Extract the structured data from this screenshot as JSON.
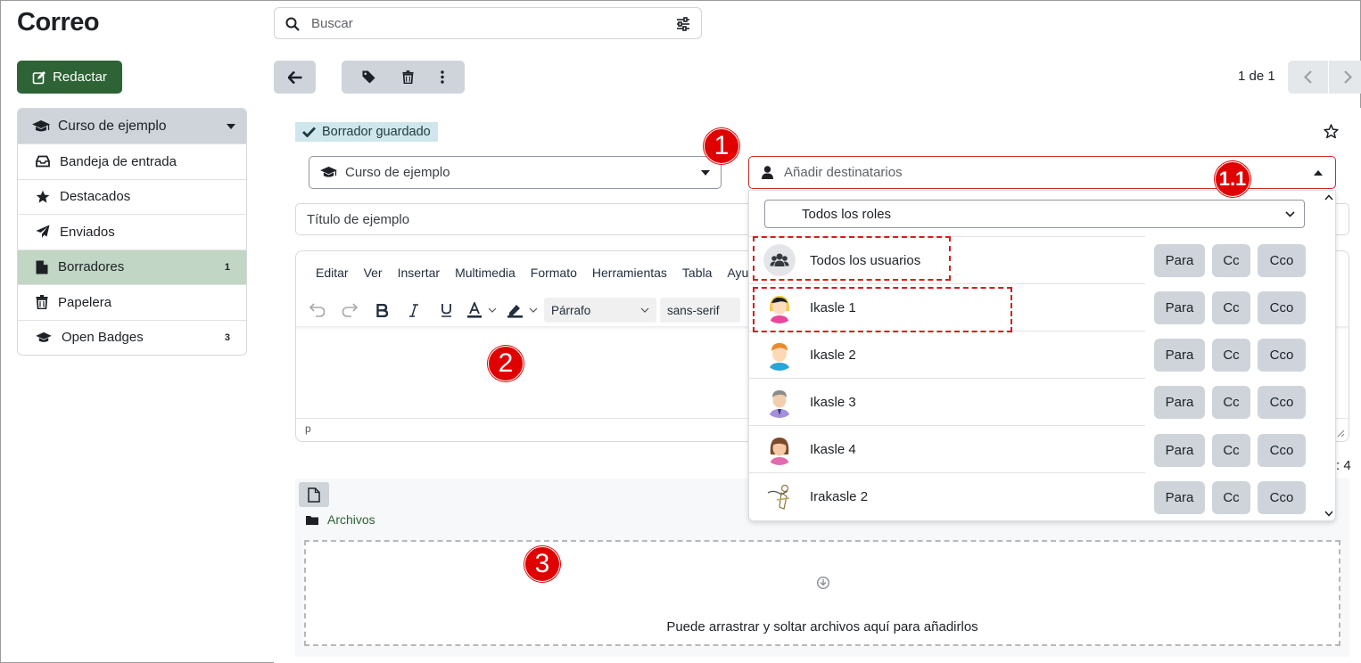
{
  "header": {
    "title": "Correo",
    "search_placeholder": "Buscar"
  },
  "sidebar": {
    "compose_label": "Redactar",
    "course": "Curso de ejemplo",
    "items": [
      {
        "label": "Bandeja de entrada",
        "count": ""
      },
      {
        "label": "Destacados",
        "count": ""
      },
      {
        "label": "Enviados",
        "count": ""
      },
      {
        "label": "Borradores",
        "count": "1"
      },
      {
        "label": "Papelera",
        "count": ""
      },
      {
        "label": "Open Badges",
        "count": "3"
      }
    ]
  },
  "toolbar": {
    "pager": "1 de 1"
  },
  "compose": {
    "saved_status": "Borrador guardado",
    "course_select": "Curso de ejemplo",
    "recipients_placeholder": "Añadir destinatarios",
    "subject": "Título de ejemplo",
    "editor": {
      "menus": [
        "Editar",
        "Ver",
        "Insertar",
        "Multimedia",
        "Formato",
        "Herramientas",
        "Tabla",
        "Ayud"
      ],
      "block_format": "Párrafo",
      "font_family": "sans-serif",
      "status_path": "p"
    },
    "count_tail": ": 4",
    "attachments": {
      "folder_label": "Archivos",
      "drop_text": "Puede arrastrar y soltar archivos aquí para añadirlos"
    }
  },
  "dropdown": {
    "role_filter": "Todos los roles",
    "buttons": [
      "Para",
      "Cc",
      "Cco"
    ],
    "rows": [
      {
        "name": "Todos los usuarios",
        "avatar": "group-icon"
      },
      {
        "name": "Ikasle 1",
        "avatar": "avatar-girl"
      },
      {
        "name": "Ikasle 2",
        "avatar": "avatar-boy"
      },
      {
        "name": "Ikasle 3",
        "avatar": "avatar-man"
      },
      {
        "name": "Ikasle 4",
        "avatar": "avatar-woman"
      },
      {
        "name": "Irakasle 2",
        "avatar": "avatar-teacher"
      }
    ]
  },
  "annotations": [
    "1",
    "1.1",
    "2",
    "3"
  ],
  "colors": {
    "primary": "#2d6335",
    "active": "#c1d6c4",
    "button": "#ced4da",
    "marker": "#e10000",
    "error_border": "#c92a2a"
  }
}
